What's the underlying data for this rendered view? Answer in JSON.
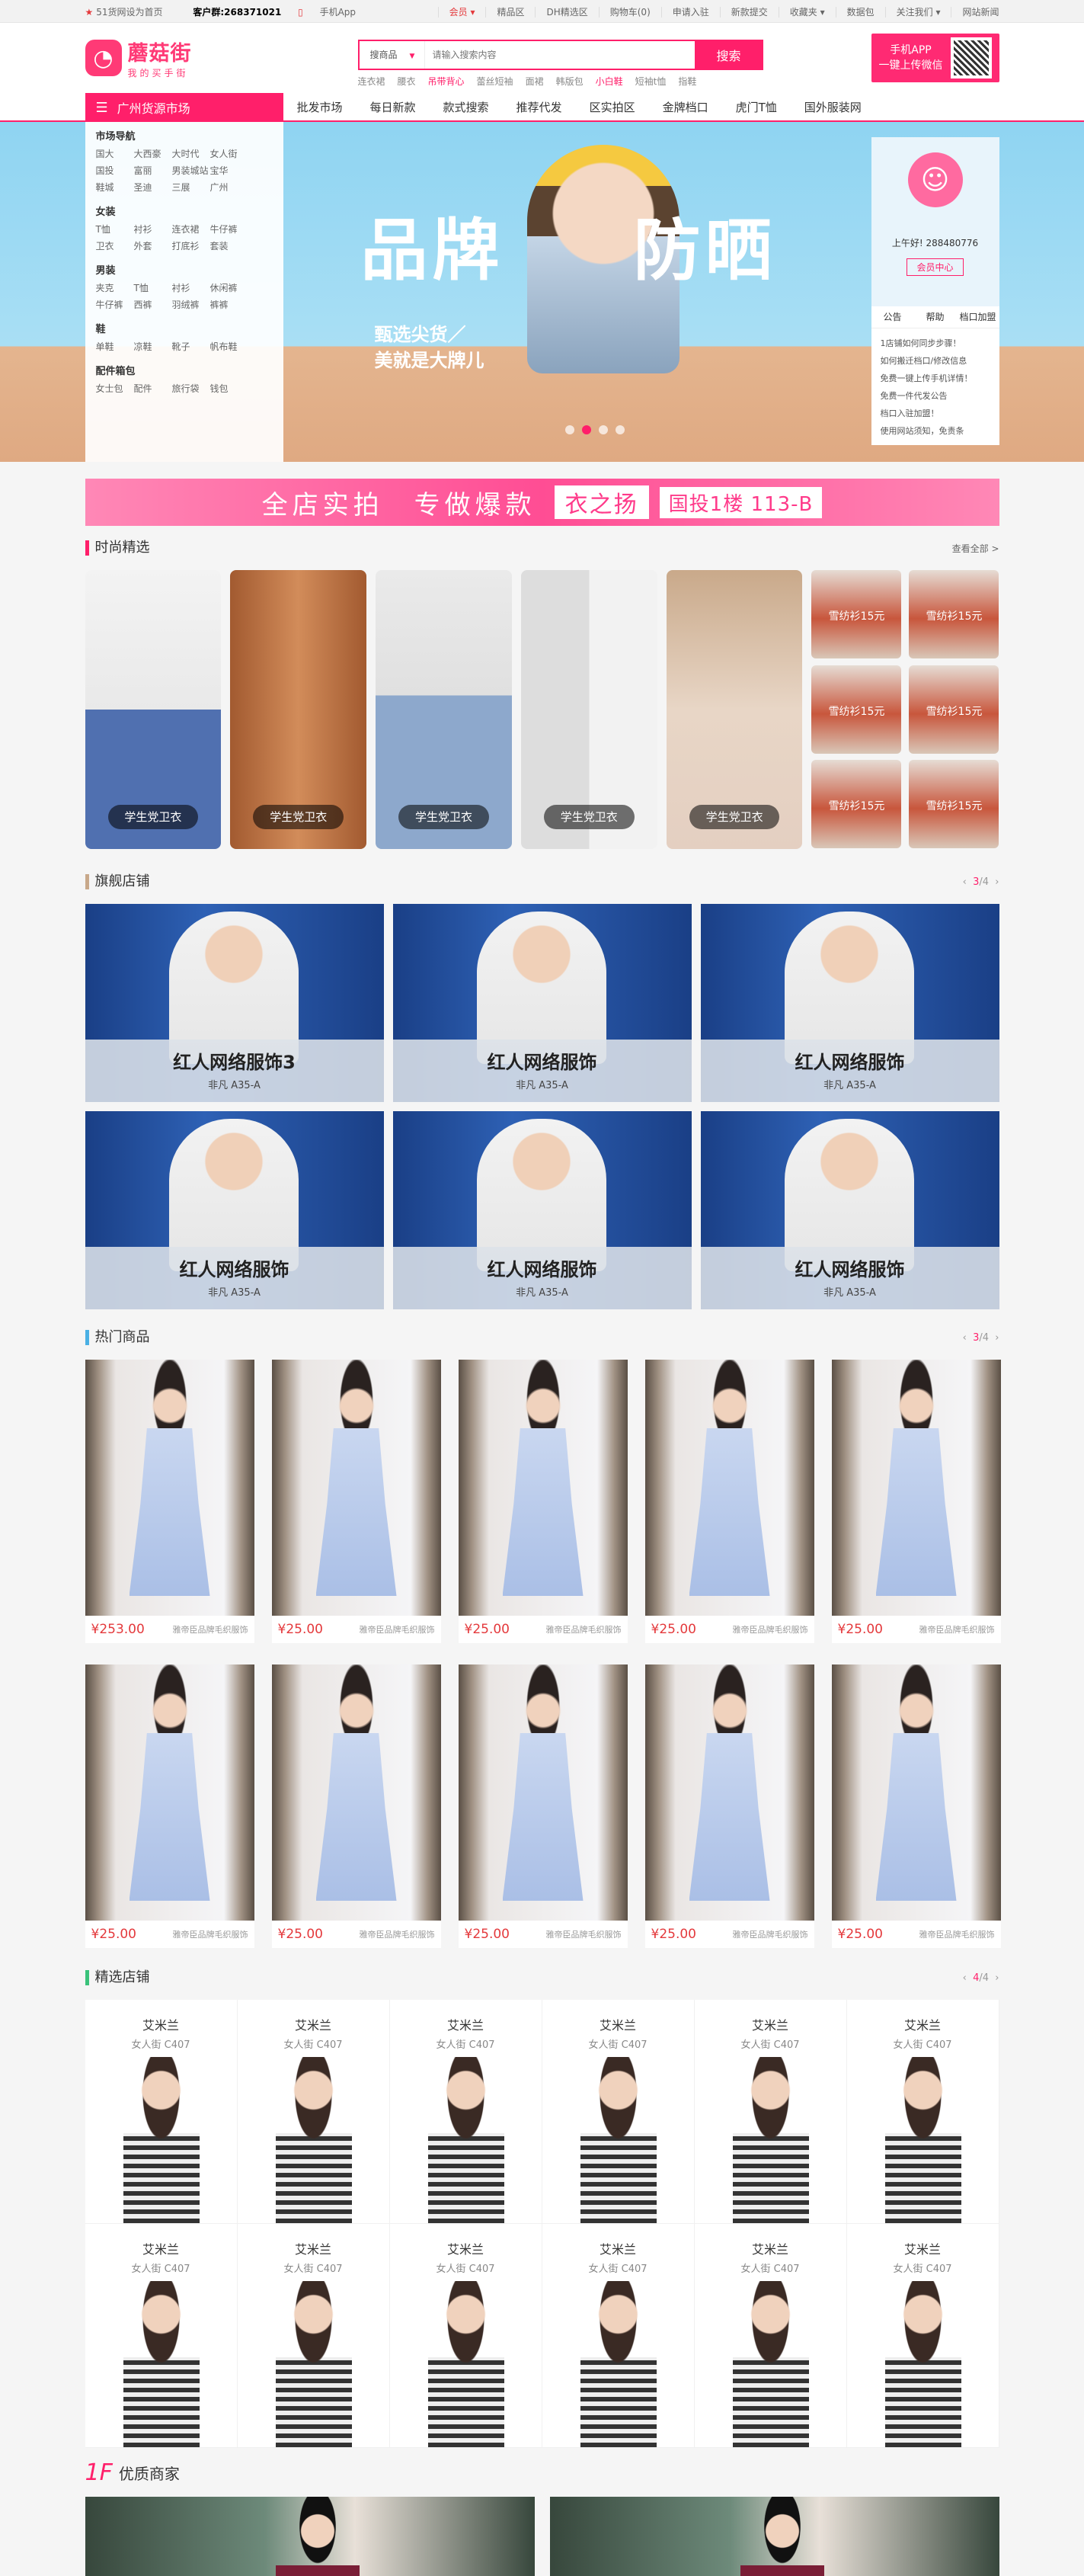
{
  "topbar": {
    "home": "51货网设为首页",
    "phone_label": "客户群:268371021",
    "mobile": "手机App",
    "links": [
      "会员 ▾",
      "精品区",
      "DH精选区",
      "购物车(0)",
      "申请入驻",
      "新款提交",
      "收藏夹 ▾",
      "数据包",
      "关注我们 ▾",
      "网站新闻"
    ]
  },
  "header": {
    "logo_text": "蘑菇街",
    "logo_sub": "我的买手街",
    "search_cat": "搜商品",
    "search_placeholder": "请输入搜索内容",
    "search_btn": "搜索",
    "hot": [
      "连衣裙",
      "腰衣",
      "吊带背心",
      "蕾丝短袖",
      "面裙",
      "韩版包",
      "小白鞋",
      "短袖t恤",
      "指鞋"
    ],
    "app_line1": "手机APP",
    "app_line2": "一键上传微信"
  },
  "nav": {
    "category": "广州货源市场",
    "items": [
      "批发市场",
      "每日新款",
      "款式搜索",
      "推荐代发",
      "区实拍区",
      "金牌档口",
      "虎门T恤",
      "国外服装网"
    ]
  },
  "sidemenu": [
    {
      "title": "市场导航",
      "items": [
        "国大",
        "大西豪",
        "大时代",
        "女人街",
        "国投",
        "富丽",
        "男装城站",
        "宝华",
        "鞋城",
        "圣迪",
        "三展",
        "广州"
      ]
    },
    {
      "title": "女装",
      "items": [
        "T恤",
        "衬衫",
        "连衣裙",
        "牛仔裤",
        "卫衣",
        "外套",
        "打底衫",
        "套装"
      ]
    },
    {
      "title": "男装",
      "items": [
        "夹克",
        "T恤",
        "衬衫",
        "休闲裤",
        "牛仔裤",
        "西裤",
        "羽绒裤",
        "裤裤"
      ]
    },
    {
      "title": "鞋",
      "items": [
        "单鞋",
        "凉鞋",
        "靴子",
        "帆布鞋"
      ]
    },
    {
      "title": "配件箱包",
      "items": [
        "女士包",
        "配件",
        "旅行袋",
        "钱包"
      ]
    }
  ],
  "banner": {
    "title1": "品牌",
    "title2": "防晒",
    "sub1": "甄选尖货／",
    "sub2": "美就是大牌儿"
  },
  "userbox": {
    "greeting": "上午好! 288480776",
    "btn": "会员中心",
    "tabs": [
      "公告",
      "帮助",
      "档口加盟"
    ],
    "notices": [
      "1店铺如何同步步骤！",
      "如何搬迁档口/修改信息",
      "免费一键上传手机详情！",
      "免费一件代发公告",
      "档口入驻加盟！",
      "使用网站须知，免责条"
    ]
  },
  "adstrip": {
    "text1": "全店实拍",
    "text2": "专做爆款",
    "brand": "衣之扬",
    "location": "国投1楼 113-B"
  },
  "fashion": {
    "title": "时尚精选",
    "more": "查看全部 >",
    "cards": [
      "学生党卫衣",
      "学生党卫衣",
      "学生党卫衣",
      "学生党卫衣",
      "学生党卫衣"
    ],
    "mini_label": "雪纺衫15元"
  },
  "flagship": {
    "title": "旗舰店铺",
    "page": "3",
    "total": "/4",
    "stores": [
      {
        "name": "红人网络服饰3",
        "loc": "非凡 A35-A"
      },
      {
        "name": "红人网络服饰",
        "loc": "非凡 A35-A"
      },
      {
        "name": "红人网络服饰",
        "loc": "非凡 A35-A"
      },
      {
        "name": "红人网络服饰",
        "loc": "非凡 A35-A"
      },
      {
        "name": "红人网络服饰",
        "loc": "非凡 A35-A"
      },
      {
        "name": "红人网络服饰",
        "loc": "非凡 A35-A"
      }
    ]
  },
  "hotgoods": {
    "title": "热门商品",
    "page": "3",
    "total": "/4",
    "items": [
      {
        "price": "¥253.00",
        "shop": "雅帝臣品牌毛织服饰"
      },
      {
        "price": "¥25.00",
        "shop": "雅帝臣品牌毛织服饰"
      },
      {
        "price": "¥25.00",
        "shop": "雅帝臣品牌毛织服饰"
      },
      {
        "price": "¥25.00",
        "shop": "雅帝臣品牌毛织服饰"
      },
      {
        "price": "¥25.00",
        "shop": "雅帝臣品牌毛织服饰"
      },
      {
        "price": "¥25.00",
        "shop": "雅帝臣品牌毛织服饰"
      },
      {
        "price": "¥25.00",
        "shop": "雅帝臣品牌毛织服饰"
      },
      {
        "price": "¥25.00",
        "shop": "雅帝臣品牌毛织服饰"
      },
      {
        "price": "¥25.00",
        "shop": "雅帝臣品牌毛织服饰"
      },
      {
        "price": "¥25.00",
        "shop": "雅帝臣品牌毛织服饰"
      }
    ]
  },
  "selected": {
    "title": "精选店铺",
    "page": "4",
    "total": "/4",
    "name": "艾米兰",
    "loc": "女人街 C407"
  },
  "floor": {
    "num": "1F",
    "title": "优质商家"
  }
}
